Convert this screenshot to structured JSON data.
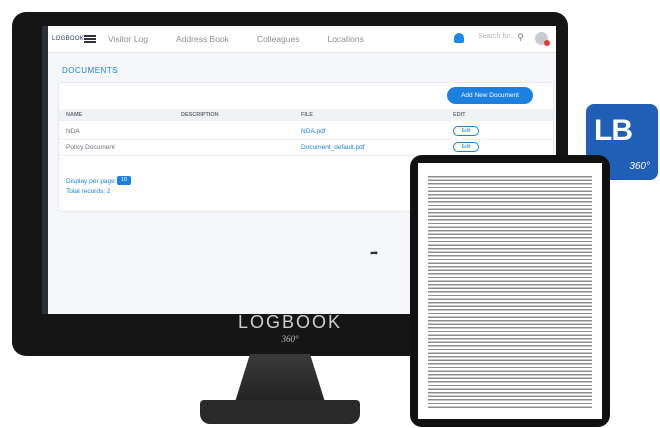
{
  "app": {
    "logo_text": "LOGBOOK",
    "nav": [
      "Visitor Log",
      "Address Book",
      "Colleagues",
      "Locations"
    ],
    "search_placeholder": "Search for..."
  },
  "page": {
    "title": "DOCUMENTS",
    "add_button": "Add New Document"
  },
  "table": {
    "headers": [
      "NAME",
      "DESCRIPTION",
      "FILE",
      "EDIT"
    ],
    "rows": [
      {
        "name": "NDA",
        "description": "",
        "file": "NDA.pdf",
        "edit": "Edit"
      },
      {
        "name": "Policy Document",
        "description": "",
        "file": "Document_default.pdf",
        "edit": "Edit"
      }
    ]
  },
  "pagination": {
    "label": "Display per page:",
    "value": "10",
    "total": "Total records: 2"
  },
  "bezel": {
    "brand": "LOGBOOK",
    "sub": "360°"
  },
  "badge": {
    "mark": "LB",
    "sub": "360°"
  },
  "colors": {
    "accent": "#1d7fe0",
    "badge": "#1f5fb5"
  }
}
